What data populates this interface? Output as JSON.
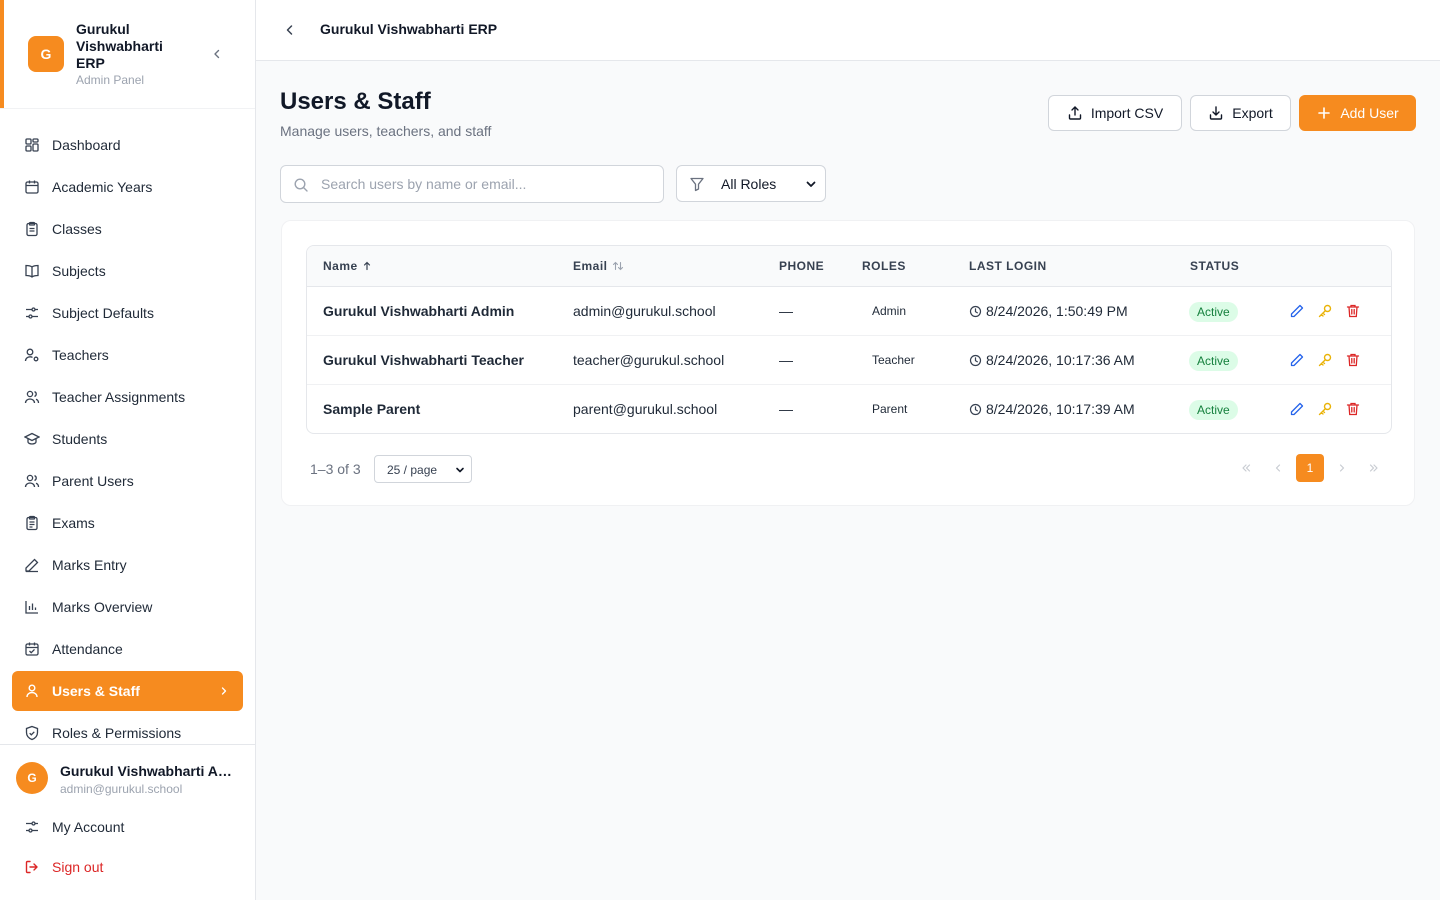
{
  "sidebar": {
    "brand": {
      "logo_letter": "G",
      "title": "Gurukul Vishwabharti ERP",
      "subtitle": "Admin Panel"
    },
    "items": [
      {
        "label": "Dashboard",
        "icon": "dashboard-icon",
        "active": false
      },
      {
        "label": "Academic Years",
        "icon": "calendar-icon",
        "active": false
      },
      {
        "label": "Classes",
        "icon": "clipboard-icon",
        "active": false
      },
      {
        "label": "Subjects",
        "icon": "book-icon",
        "active": false
      },
      {
        "label": "Subject Defaults",
        "icon": "settings-sliders-icon",
        "active": false
      },
      {
        "label": "Teachers",
        "icon": "user-cog-icon",
        "active": false
      },
      {
        "label": "Teacher Assignments",
        "icon": "users-icon",
        "active": false
      },
      {
        "label": "Students",
        "icon": "graduation-cap-icon",
        "active": false
      },
      {
        "label": "Parent Users",
        "icon": "users-icon",
        "active": false
      },
      {
        "label": "Exams",
        "icon": "clipboard-list-icon",
        "active": false
      },
      {
        "label": "Marks Entry",
        "icon": "pencil-icon",
        "active": false
      },
      {
        "label": "Marks Overview",
        "icon": "bar-chart-icon",
        "active": false
      },
      {
        "label": "Attendance",
        "icon": "calendar-check-icon",
        "active": false
      },
      {
        "label": "Users & Staff",
        "icon": "user-icon",
        "active": true
      },
      {
        "label": "Roles & Permissions",
        "icon": "shield-icon",
        "active": false
      }
    ],
    "user": {
      "avatar_letter": "G",
      "name": "Gurukul Vishwabharti Admin",
      "email": "admin@gurukul.school"
    },
    "my_account_label": "My Account",
    "sign_out_label": "Sign out"
  },
  "topbar": {
    "title": "Gurukul Vishwabharti ERP"
  },
  "page": {
    "title": "Users & Staff",
    "subtitle": "Manage users, teachers, and staff"
  },
  "actions": {
    "import_label": "Import CSV",
    "export_label": "Export",
    "add_label": "Add User"
  },
  "filters": {
    "search_placeholder": "Search users by name or email...",
    "search_value": "",
    "role_selected": "All Roles"
  },
  "table": {
    "headers": {
      "name": "Name",
      "email": "Email",
      "phone": "PHONE",
      "roles": "ROLES",
      "last_login": "LAST LOGIN",
      "status": "STATUS"
    },
    "rows": [
      {
        "name": "Gurukul Vishwabharti Admin",
        "email": "admin@gurukul.school",
        "phone": "—",
        "role": "Admin",
        "last_login": "8/24/2026, 1:50:49 PM",
        "status": "Active"
      },
      {
        "name": "Gurukul Vishwabharti Teacher",
        "email": "teacher@gurukul.school",
        "phone": "—",
        "role": "Teacher",
        "last_login": "8/24/2026, 10:17:36 AM",
        "status": "Active"
      },
      {
        "name": "Sample Parent",
        "email": "parent@gurukul.school",
        "phone": "—",
        "role": "Parent",
        "last_login": "8/24/2026, 10:17:39 AM",
        "status": "Active"
      }
    ]
  },
  "pagination": {
    "range_text": "1–3 of 3",
    "page_size": "25 / page",
    "current_page": "1"
  },
  "colors": {
    "accent": "#f68b1f",
    "edit": "#2563eb",
    "key": "#eab308",
    "delete": "#dc2626",
    "status_bg": "#dcfce7",
    "status_text": "#15803d"
  }
}
